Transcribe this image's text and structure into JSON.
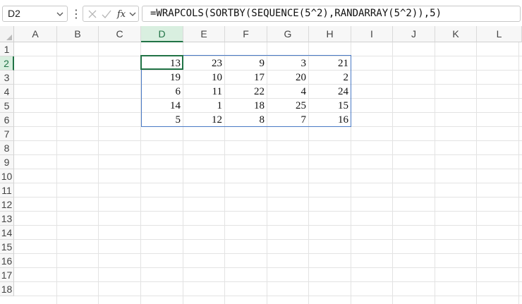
{
  "formula_bar": {
    "name_box": "D2",
    "more_glyph": "⋮",
    "formula": "=WRAPCOLS(SORTBY(SEQUENCE(5^2),RANDARRAY(5^2)),5)",
    "icons": [
      "chevron-down-icon",
      "more-vertical-icon",
      "cancel-x-icon",
      "confirm-check-icon",
      "fx-icon",
      "chevron-down-icon"
    ]
  },
  "sheet": {
    "columns": [
      "A",
      "B",
      "C",
      "D",
      "E",
      "F",
      "G",
      "H",
      "I",
      "J",
      "K",
      "L"
    ],
    "rows": [
      "1",
      "2",
      "3",
      "4",
      "5",
      "6",
      "7",
      "8",
      "9",
      "10",
      "11",
      "12",
      "13",
      "14",
      "15",
      "16",
      "17",
      "18"
    ],
    "selected_column": "D",
    "selected_row": "2",
    "active_cell": "D2",
    "cells": {
      "D2": "13",
      "E2": "23",
      "F2": "9",
      "G2": "3",
      "H2": "21",
      "D3": "19",
      "E3": "10",
      "F3": "17",
      "G3": "20",
      "H3": "2",
      "D4": "6",
      "E4": "11",
      "F4": "22",
      "G4": "4",
      "H4": "24",
      "D5": "14",
      "E5": "1",
      "F5": "18",
      "G5": "25",
      "H5": "15",
      "D6": "5",
      "E6": "12",
      "F6": "8",
      "G6": "7",
      "H6": "16"
    }
  },
  "colors": {
    "accent_green": "#217346",
    "range_blue": "#4a7ac5",
    "header_selected_bg": "#d9efe0"
  }
}
